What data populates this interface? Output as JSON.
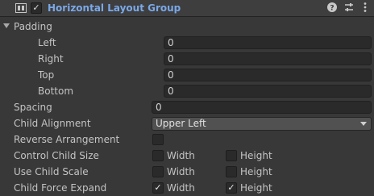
{
  "component": {
    "title": "Horizontal Layout Group",
    "enabled_mark": "✓",
    "icons": [
      "layout-group-icon",
      "help-icon",
      "preset-icon",
      "more-icon"
    ]
  },
  "padding": {
    "label": "Padding",
    "left": {
      "label": "Left",
      "value": "0"
    },
    "right": {
      "label": "Right",
      "value": "0"
    },
    "top": {
      "label": "Top",
      "value": "0"
    },
    "bottom": {
      "label": "Bottom",
      "value": "0"
    }
  },
  "spacing": {
    "label": "Spacing",
    "value": "0"
  },
  "child_alignment": {
    "label": "Child Alignment",
    "value": "Upper Left"
  },
  "reverse_arrangement": {
    "label": "Reverse Arrangement",
    "checked": false
  },
  "control_child_size": {
    "label": "Control Child Size",
    "width": {
      "label": "Width",
      "checked": false,
      "mark": ""
    },
    "height": {
      "label": "Height",
      "checked": false,
      "mark": ""
    }
  },
  "use_child_scale": {
    "label": "Use Child Scale",
    "width": {
      "label": "Width",
      "checked": false,
      "mark": ""
    },
    "height": {
      "label": "Height",
      "checked": false,
      "mark": ""
    }
  },
  "child_force_expand": {
    "label": "Child Force Expand",
    "width": {
      "label": "Width",
      "checked": true,
      "mark": "✓"
    },
    "height": {
      "label": "Height",
      "checked": true,
      "mark": "✓"
    }
  }
}
